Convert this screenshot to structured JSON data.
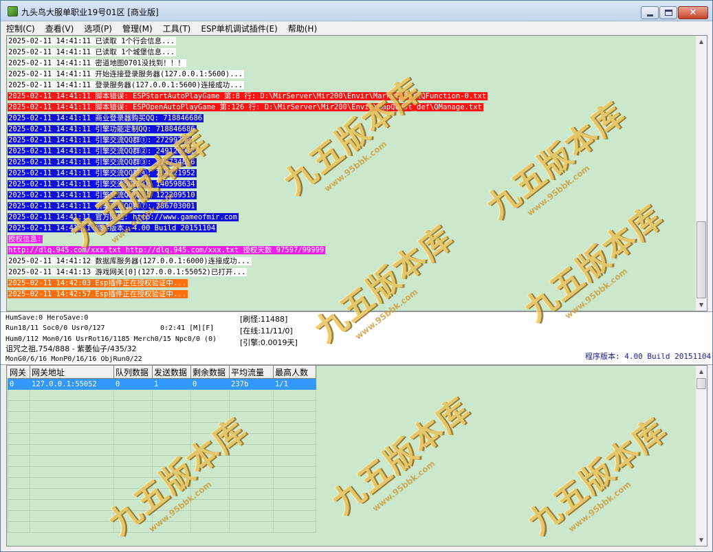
{
  "window": {
    "title": "九头鸟大服单职业19号01区 [商业版]",
    "icon": "dragon-app-icon",
    "controls": {
      "minimize": "minimize-icon",
      "maximize": "maximize-icon",
      "close": "✕"
    }
  },
  "menu": [
    {
      "label": "控制(C)"
    },
    {
      "label": "查看(V)"
    },
    {
      "label": "选项(P)"
    },
    {
      "label": "管理(M)"
    },
    {
      "label": "工具(T)"
    },
    {
      "label": "ESP单机调试插件(E)"
    },
    {
      "label": "帮助(H)"
    }
  ],
  "log": [
    {
      "type": "normal",
      "text": "2025-02-11 14:41:11 已读取 1个行会信息..."
    },
    {
      "type": "normal",
      "text": "2025-02-11 14:41:11 已读取 1个城堡信息..."
    },
    {
      "type": "normal",
      "text": "2025-02-11 14:41:11 密道地图0701没找到！！！"
    },
    {
      "type": "normal",
      "text": "2025-02-11 14:41:11 开始连接登录服务器(127.0.0.1:5600)..."
    },
    {
      "type": "normal",
      "text": "2025-02-11 14:41:11 登录服务器(127.0.0.1:5600)连接成功..."
    },
    {
      "type": "error",
      "text": "2025-02-11 14:41:11 脚本错误: ESPStartAutoPlayGame 第:8 行: D:\\MirServer\\Mir200\\Envir\\Market_Def\\QFunction-0.txt"
    },
    {
      "type": "error",
      "text": "2025-02-11 14:41:11 脚本错误: ESPOpenAutoPlayGame 第:126 行: D:\\MirServer\\Mir200\\Envir\\MapQuest_def\\QManage.txt"
    },
    {
      "type": "info",
      "text": "2025-02-11 14:41:11 商业登录器购买QQ: 718846686"
    },
    {
      "type": "info",
      "text": "2025-02-11 14:41:11 引擎功能定制QQ: 718846686"
    },
    {
      "type": "info",
      "text": "2025-02-11 14:41:11 引擎交流QQ群①: 27299223"
    },
    {
      "type": "info",
      "text": "2025-02-11 14:41:11 引擎交流QQ群②: 249126912"
    },
    {
      "type": "info",
      "text": "2025-02-11 14:41:11 引擎交流QQ群③: 277734856"
    },
    {
      "type": "info",
      "text": "2025-02-11 14:41:11 引擎交流QQ群④: 264221952"
    },
    {
      "type": "info",
      "text": "2025-02-11 14:41:11 引擎交流QQ群④: 140598634"
    },
    {
      "type": "info",
      "text": "2025-02-11 14:41:11 引擎交流QQ群⑥: 122209510"
    },
    {
      "type": "info",
      "text": "2025-02-11 14:41:11 引擎交流QQ群⑦: 286703001"
    },
    {
      "type": "info",
      "text": "2025-02-11 14:41:11 官方网站: http://www.gameofmir.com"
    },
    {
      "type": "info",
      "text": "2025-02-11 14:41:11 程序版本: 4.00 Build 20151104"
    },
    {
      "type": "license",
      "text": "授权信息:"
    },
    {
      "type": "license",
      "text": "http://dlq.945.com/xxx.txt http://dlq.945.com/xxx.txt 授权天数 97597/99999"
    },
    {
      "type": "normal",
      "text": "2025-02-11 14:41:12 数据库服务器(127.0.0.1:6000)连接成功..."
    },
    {
      "type": "normal",
      "text": "2025-02-11 14:41:13 游戏网关[0](127.0.0.1:55052)已打开..."
    },
    {
      "type": "warning",
      "text": "2025-02-11 14:42:03 Esp插件正在授权验证中..."
    },
    {
      "type": "warning",
      "text": "2025-02-11 14:42:57 Esp插件正在授权验证中..."
    }
  ],
  "status": {
    "save": "HumSave:0 HeroSave:0",
    "run": "Run18/11 Soc0/0 Usr0/127",
    "time": "0:2:41 [M][F]",
    "objects": "Hum0/112 Mon0/16 UsrRot16/1185 Merch0/15 Npc0/0 (0)",
    "map": "诅咒之祖,754/888 - 紫萎仙子/435/32",
    "mon_gen": "MonG0/6/16 MonP0/16/16 ObjRun0/22",
    "refresh": "[刷怪:11488]",
    "online": "[在线:11/11/0]",
    "engine": "[引擎:0.0019天]",
    "version": "程序版本: 4.00 Build 20151104"
  },
  "gateway_table": {
    "columns": [
      "网关",
      "网关地址",
      "队列数据",
      "发送数据",
      "剩余数据",
      "平均流量",
      "最高人数"
    ],
    "rows": [
      [
        "0",
        "127.0.0.1:55052",
        "0",
        "1",
        "0",
        "237b",
        "1/1"
      ]
    ]
  },
  "watermark": {
    "main": "九五版本库",
    "sub": "www.95bbk.com"
  },
  "colors": {
    "log_background": "#cce8cc",
    "error": "#ff1212",
    "info": "#1010e0",
    "license": "#ee1fee",
    "warning": "#ff6e0c",
    "selected_row": "#3399ff"
  }
}
